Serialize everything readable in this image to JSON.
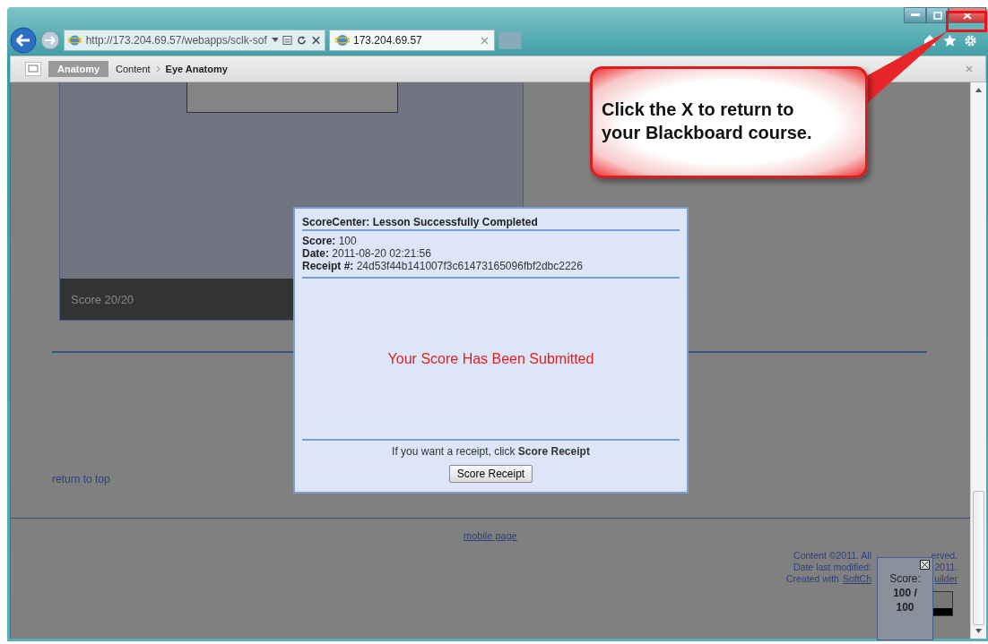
{
  "browser": {
    "address": "http://173.204.69.57/webapps/sclk-sof",
    "tab": {
      "title": "173.204.69.57"
    }
  },
  "toolbar": {
    "course": "Anatomy",
    "breadcrumb": [
      "Content",
      "Eye Anatomy"
    ]
  },
  "lesson": {
    "score_bar": "Score 20/20"
  },
  "links": {
    "return_to_top": "return to top",
    "mobile_page": "mobile page"
  },
  "footer_lines": [
    {
      "left": [
        {
          "kind": "text",
          "text": "Content ©2011. All"
        }
      ],
      "right": [
        {
          "kind": "text",
          "text": "erved."
        }
      ]
    },
    {
      "left": [
        {
          "kind": "text",
          "text": "Date last modified:"
        }
      ],
      "right": [
        {
          "kind": "text",
          "text": "2011."
        }
      ]
    },
    {
      "left": [
        {
          "kind": "text",
          "text": "Created with"
        },
        {
          "kind": "link",
          "text": "SoftCh"
        }
      ],
      "right": [
        {
          "kind": "link",
          "text": "uilder"
        }
      ]
    }
  ],
  "dialog": {
    "title": "ScoreCenter: Lesson Successfully Completed",
    "fields": [
      {
        "label": "Score:",
        "value": "100"
      },
      {
        "label": "Date:",
        "value": "2011-08-20 02:21:56"
      },
      {
        "label": "Receipt #:",
        "value": "24d53f44b141007f3c61473165096fbf2dbc2226"
      }
    ],
    "message": "Your Score Has Been Submitted",
    "hint": "If you want a receipt, click **Score Receipt**",
    "button": "Score Receipt"
  },
  "score_widget": {
    "label": "Score:",
    "value": "100 / 100"
  },
  "callout": {
    "text": "Click the X to return to your Blackboard course."
  }
}
